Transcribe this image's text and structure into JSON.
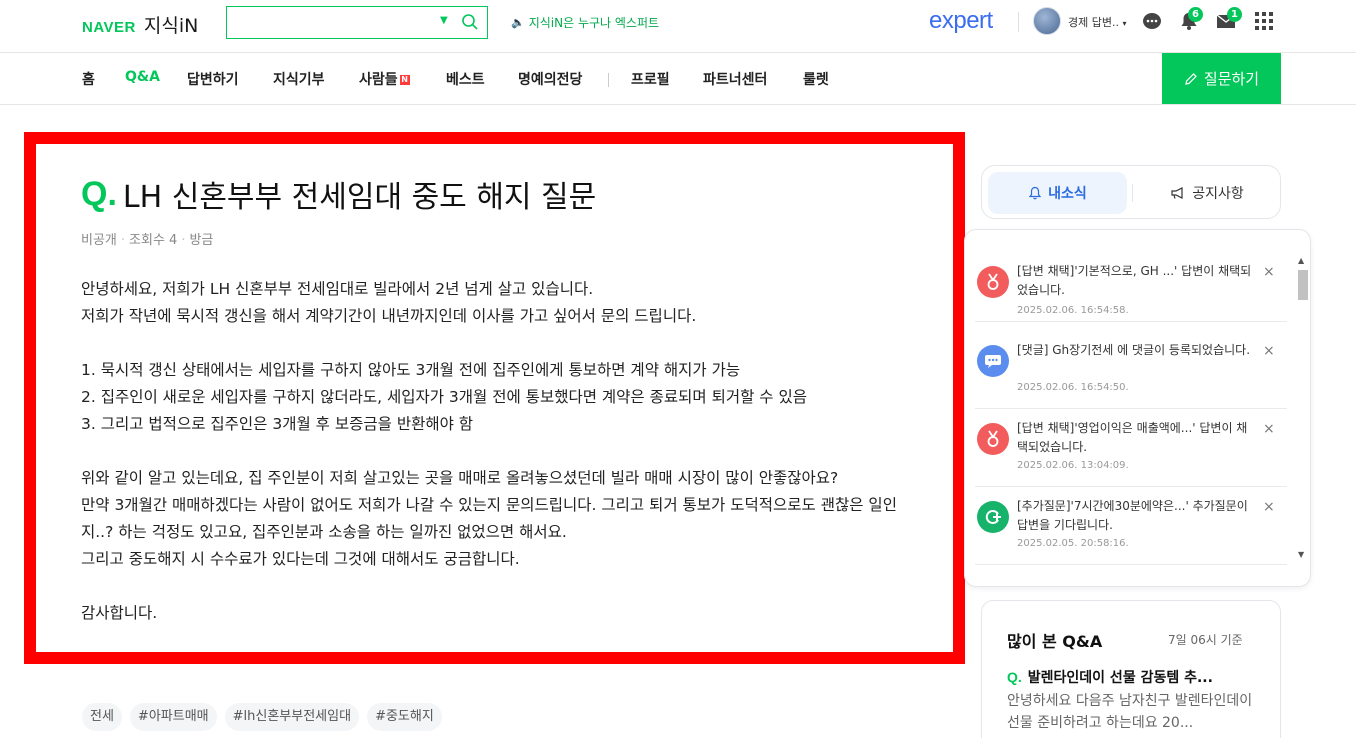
{
  "header": {
    "logo_naver": "NAVER",
    "logo_kin": "지식iN",
    "search_value": "",
    "promo_text": "지식iN은 누구나 엑스퍼트",
    "expert_logo": "expert",
    "user_name": "경제 답변..",
    "notifications_count": "6",
    "messages_count": "1"
  },
  "nav": {
    "items": [
      "홈",
      "Q&A",
      "답변하기",
      "지식기부",
      "사람들",
      "베스트",
      "명예의전당",
      "프로필",
      "파트너센터",
      "룰렛"
    ],
    "new_badge": "N",
    "ask_button": "질문하기"
  },
  "question": {
    "q_mark": "Q.",
    "title": "LH 신혼부부 전세임대 중도 해지 질문",
    "meta": {
      "visibility": "비공개",
      "views": "조회수 4",
      "time": "방금"
    },
    "paragraphs": [
      "안녕하세요, 저희가 LH 신혼부부 전세임대로 빌라에서 2년 넘게 살고 있습니다.\n저희가 작년에 묵시적 갱신을 해서 계약기간이 내년까지인데 이사를 가고 싶어서 문의 드립니다.",
      "1. 묵시적 갱신 상태에서는 세입자를 구하지 않아도 3개월 전에 집주인에게 통보하면 계약 해지가 가능\n2. 집주인이 새로운 세입자를 구하지 않더라도, 세입자가 3개월 전에 통보했다면 계약은 종료되며 퇴거할 수 있음\n3. 그리고 법적으로 집주인은 3개월 후 보증금을 반환해야 함",
      "위와 같이 알고 있는데요, 집 주인분이 저희 살고있는 곳을 매매로 올려놓으셨던데 빌라 매매 시장이 많이 안좋잖아요?\n만약 3개월간 매매하겠다는 사람이 없어도 저희가 나갈 수 있는지 문의드립니다. 그리고 퇴거 통보가 도덕적으로도 괜찮은 일인지..? 하는 걱정도 있고요, 집주인분과 소송을 하는 일까진 없었으면 해서요.\n그리고 중도해지 시 수수료가 있다는데 그것에 대해서도 궁금합니다.",
      "감사합니다."
    ],
    "tags": [
      "전세",
      "#아파트매매",
      "#lh신혼부부전세임대",
      "#중도해지"
    ]
  },
  "sidebar": {
    "tab_mine": "내소식",
    "tab_notice": "공지사항",
    "notifications": [
      {
        "icon": "medal-icon",
        "color": "#f25c5c",
        "text": "[답변 채택]'기본적으로, GH ...' 답변이 채택되었습니다.",
        "time": "2025.02.06. 16:54:58."
      },
      {
        "icon": "comment-icon",
        "color": "#5b8def",
        "text": "[댓글] Gh장기전세 에 댓글이 등록되었습니다.",
        "time": "2025.02.06. 16:54:50."
      },
      {
        "icon": "medal-icon",
        "color": "#f25c5c",
        "text": "[답변 채택]'영업이익은 매출액에...' 답변이 채택되었습니다.",
        "time": "2025.02.06. 13:04:09."
      },
      {
        "icon": "add-question-icon",
        "color": "#18b36b",
        "text": "[추가질문]'7시간에30분에약은...' 추가질문이 답변을 기다립니다.",
        "time": "2025.02.05. 20:58:16."
      }
    ],
    "close_glyph": "×",
    "popular": {
      "title": "많이 본 Q&A",
      "time": "7일 06시 기준",
      "q_mark": "Q.",
      "question": "발렌타인데이 선물 감동템 추...",
      "desc": "안녕하세요 다음주 남자친구 발렌타인데이 선물 준비하려고 하는데요 20..."
    }
  },
  "colors": {
    "brand": "#03c75a",
    "highlight": "#ff0000",
    "expert": "#3a6df0"
  }
}
